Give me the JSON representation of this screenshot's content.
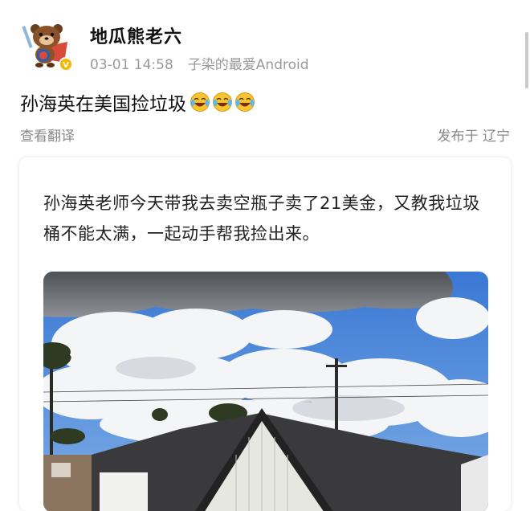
{
  "post": {
    "user": {
      "name": "地瓜熊老六",
      "avatar": "bear-mascot-avatar",
      "verified_badge": "V"
    },
    "time": "03-01 14:58",
    "source": "子染的最爱Android",
    "text": "孙海英在美国捡垃圾",
    "emojis": [
      "laugh-cry-emoji",
      "laugh-cry-emoji",
      "laugh-cry-emoji"
    ],
    "translate_label": "查看翻译",
    "location": "发布于 辽宁"
  },
  "card": {
    "text": "孙海英老师今天带我去卖空瓶子卖了21美金，又教我垃圾桶不能太满，一起动手帮我捡出来。",
    "photo": "sky-clouds-house-roof-photo"
  },
  "colors": {
    "meta_gray": "#9a9a9a",
    "verified_yellow": "#f5b800",
    "sky_blue": "#3f80d8"
  }
}
